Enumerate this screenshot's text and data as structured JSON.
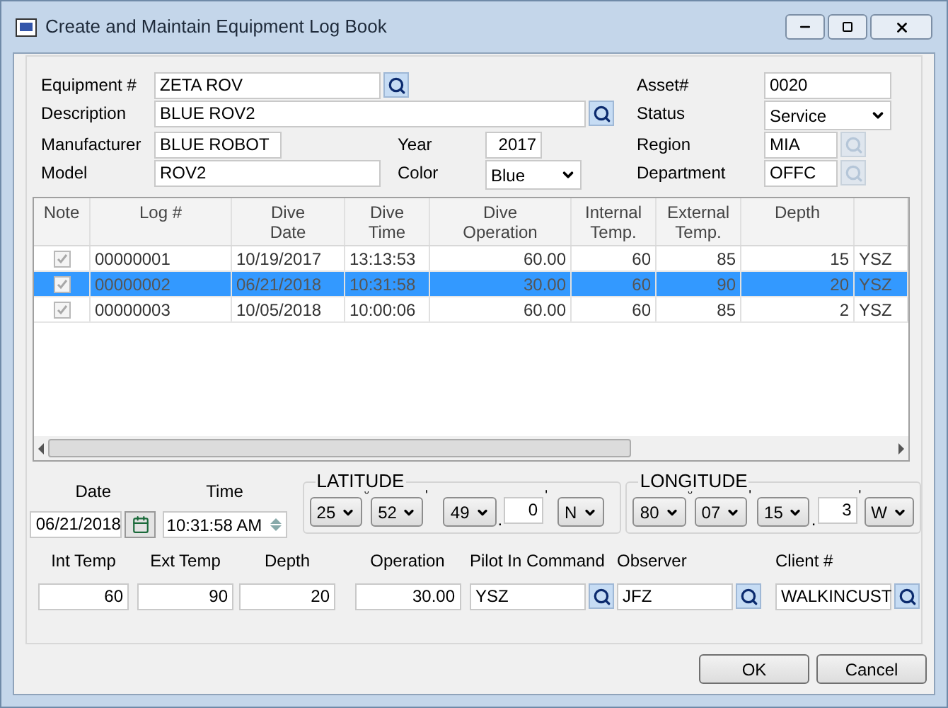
{
  "window": {
    "title": "Create and Maintain Equipment Log Book"
  },
  "header": {
    "equipment": {
      "label": "Equipment #",
      "value": "ZETA ROV",
      "lookup_disabled": false
    },
    "description": {
      "label": "Description",
      "value": "BLUE ROV2",
      "lookup_disabled": false
    },
    "manufacturer": {
      "label": "Manufacturer",
      "value": "BLUE ROBOT"
    },
    "model": {
      "label": "Model",
      "value": "ROV2"
    },
    "year": {
      "label": "Year",
      "value": "2017"
    },
    "color": {
      "label": "Color",
      "value": "Blue"
    },
    "asset": {
      "label": "Asset#",
      "value": "0020"
    },
    "status": {
      "label": "Status",
      "value": "Service"
    },
    "region": {
      "label": "Region",
      "value": "MIA",
      "lookup_disabled": true
    },
    "department": {
      "label": "Department",
      "value": "OFFC",
      "lookup_disabled": true
    }
  },
  "table": {
    "columns": [
      "Note",
      "Log #",
      "Dive\nDate",
      "Dive\nTime",
      "Dive\nOperation",
      "Internal\nTemp.",
      "External\nTemp.",
      "Depth",
      ""
    ],
    "rows": [
      {
        "note_checked": true,
        "selected": false,
        "cells": [
          "",
          "00000001",
          "10/19/2017",
          "13:13:53",
          "60.00",
          "60",
          "85",
          "15",
          "YSZ"
        ]
      },
      {
        "note_checked": true,
        "selected": true,
        "cells": [
          "",
          "00000002",
          "06/21/2018",
          "10:31:58",
          "30.00",
          "60",
          "90",
          "20",
          "YSZ"
        ]
      },
      {
        "note_checked": true,
        "selected": false,
        "cells": [
          "",
          "00000003",
          "10/05/2018",
          "10:00:06",
          "60.00",
          "60",
          "85",
          "2",
          "YSZ"
        ]
      }
    ]
  },
  "date": {
    "label": "Date",
    "value": "06/21/2018"
  },
  "time": {
    "label": "Time",
    "value": "10:31:58 AM"
  },
  "coordinates": [
    {
      "label": "LATITUDE",
      "degrees": "25",
      "minutes": "52",
      "seconds": "49",
      "fraction": "0",
      "hemisphere": "N",
      "marks": [
        "°",
        "'",
        ".",
        "'"
      ]
    },
    {
      "label": "LONGITUDE",
      "degrees": "80",
      "minutes": "07",
      "seconds": "15",
      "fraction": "3",
      "hemisphere": "W",
      "marks": [
        "°",
        "'",
        ".",
        "'"
      ]
    }
  ],
  "details": [
    {
      "label": "Int Temp",
      "value": "60",
      "lookup": false
    },
    {
      "label": "Ext Temp",
      "value": "90",
      "lookup": false
    },
    {
      "label": "Depth",
      "value": "20",
      "lookup": false
    },
    {
      "label": "Operation",
      "value": "30.00",
      "lookup": false
    },
    {
      "label": "Pilot In Command",
      "value": "YSZ",
      "lookup": true
    },
    {
      "label": "Observer",
      "value": "JFZ",
      "lookup": true
    },
    {
      "label": "Client #",
      "value": "WALKINCUST",
      "lookup": true
    }
  ],
  "buttons": [
    "OK",
    "Cancel"
  ]
}
